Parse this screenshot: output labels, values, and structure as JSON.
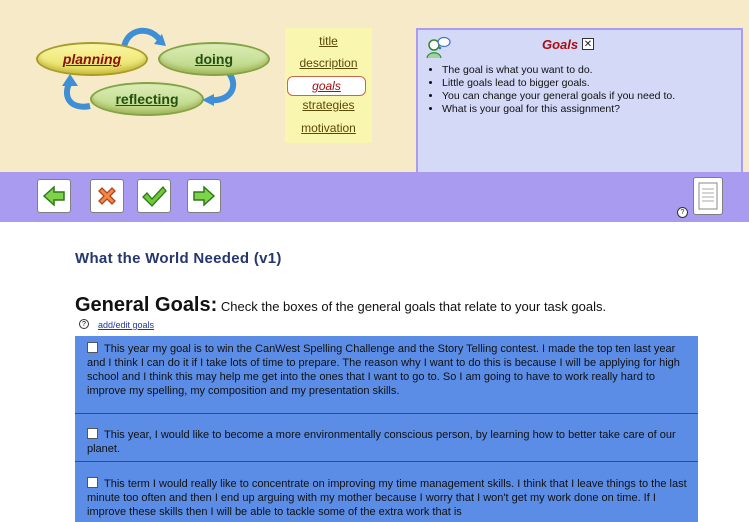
{
  "cycle": {
    "planning": "planning",
    "doing": "doing",
    "reflecting": "reflecting"
  },
  "menu": {
    "items": [
      "title",
      "description",
      "goals",
      "strategies",
      "motivation"
    ],
    "active": "goals"
  },
  "goals_panel": {
    "title": "Goals",
    "close": "✕",
    "bullets": [
      "The goal is what you want to do.",
      "Little goals lead to bigger goals.",
      "You can change your general goals if you need to.",
      "What is your goal for this assignment?"
    ]
  },
  "toolbar": {
    "help": "?"
  },
  "content": {
    "doc_title": "What the World Needed (v1)",
    "heading": "General Goals:",
    "instruction": "Check the boxes of the general goals that relate to your task goals.",
    "help": "?",
    "add_edit": "add/edit goals",
    "goals": [
      "This year my goal is to win the CanWest Spelling Challenge and the Story Telling contest. I made the top ten last year and I think I can do it if I take lots of time to prepare. The reason why I want to do this is because I will be applying for high school and I think this may help me get into the ones that I want to go to. So I am going to have to work really hard to improve my spelling, my composition and my presentation skills.",
      "This year, I would like to become a more environmentally conscious person, by learning how to better take care of our planet.",
      "This term I would really like to concentrate on improving my time management skills. I think that I leave things to the last minute too often and then I end up arguing with my mother because I worry that I won't get my work done on time. If I improve these skills then I will be able to tackle some of the extra work that is"
    ]
  }
}
